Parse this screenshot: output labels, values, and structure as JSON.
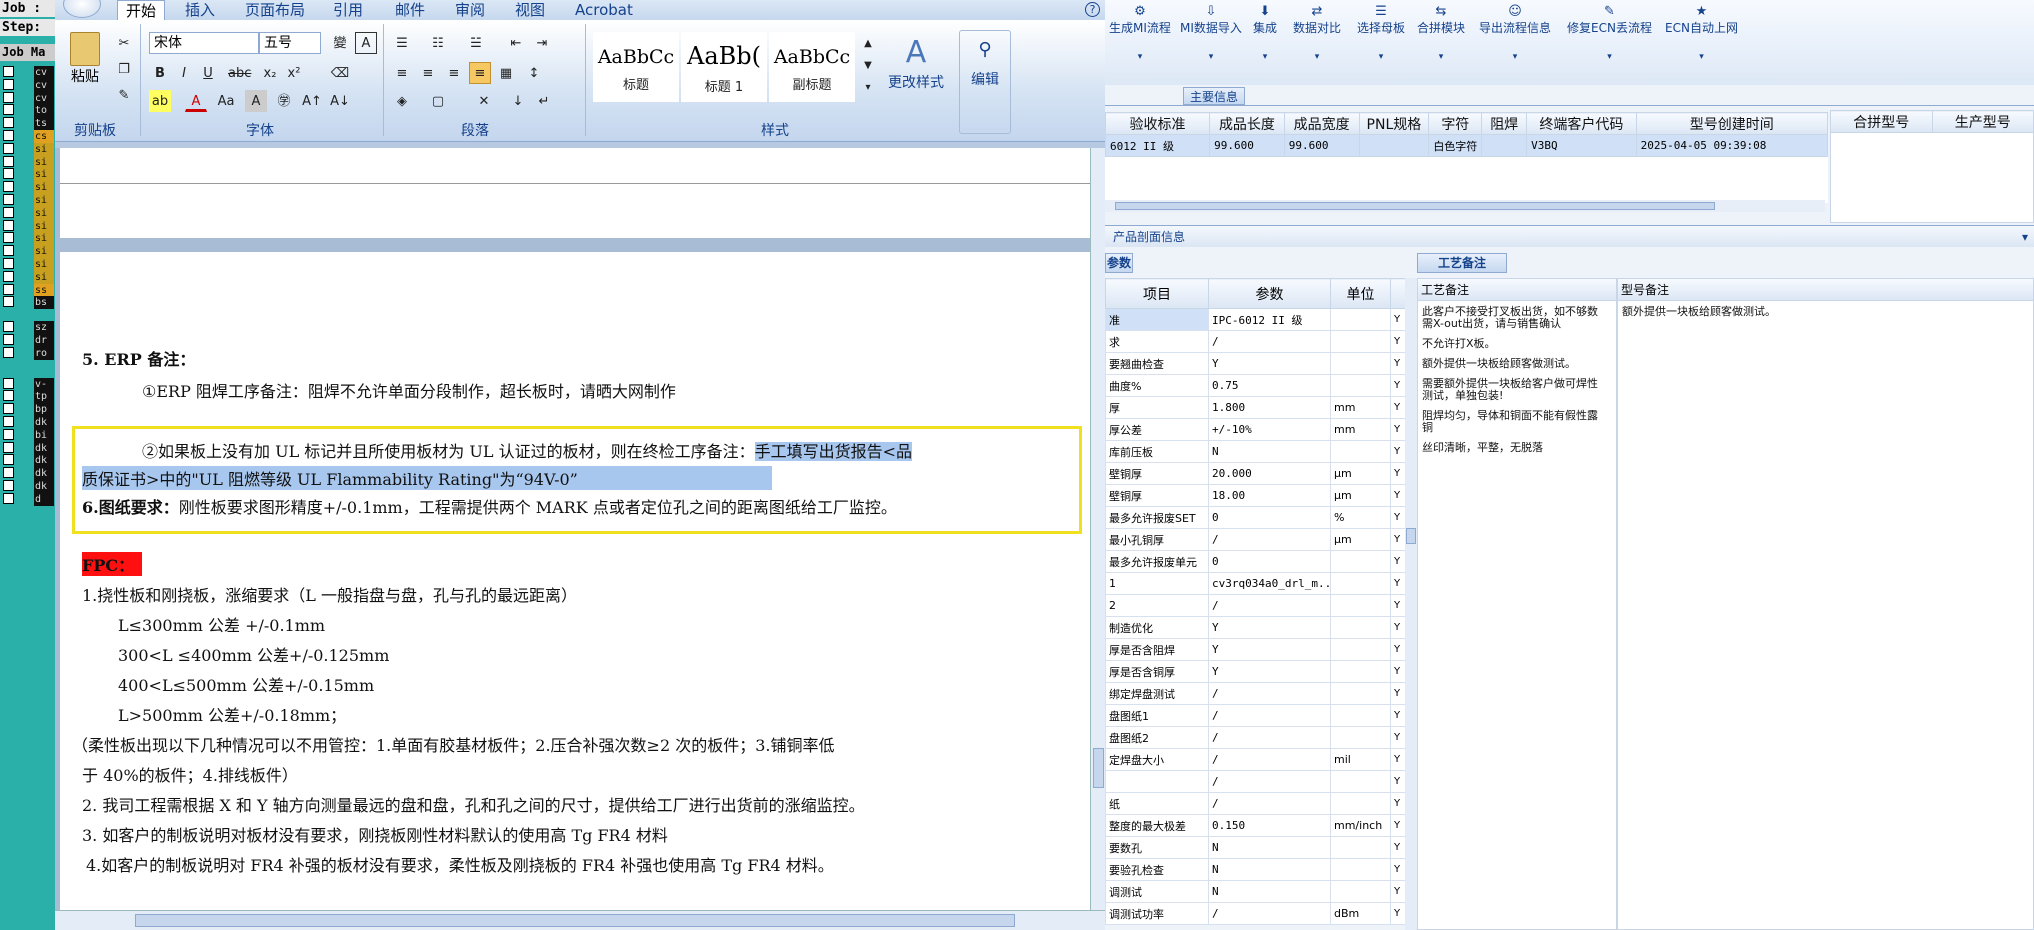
{
  "terminal": {
    "job_label": "Job :",
    "step_label": "Step:",
    "job_header": "Job Ma",
    "rows": [
      {
        "text": "cv",
        "color": "dark"
      },
      {
        "text": "cv",
        "color": "dark"
      },
      {
        "text": "cv",
        "color": "dark"
      },
      {
        "text": "to",
        "color": "dark"
      },
      {
        "text": "ts",
        "color": "dark"
      },
      {
        "text": "cs",
        "color": "orange"
      },
      {
        "text": "si",
        "color": "yellow"
      },
      {
        "text": "si",
        "color": "yellow"
      },
      {
        "text": "si",
        "color": "yellow"
      },
      {
        "text": "si",
        "color": "yellow"
      },
      {
        "text": "si",
        "color": "yellow"
      },
      {
        "text": "si",
        "color": "yellow"
      },
      {
        "text": "si",
        "color": "yellow"
      },
      {
        "text": "si",
        "color": "yellow"
      },
      {
        "text": "si",
        "color": "yellow"
      },
      {
        "text": "si",
        "color": "yellow"
      },
      {
        "text": "si",
        "color": "yellow"
      },
      {
        "text": "ss",
        "color": "orange"
      },
      {
        "text": "bs",
        "color": "dark"
      },
      {
        "text": "sz",
        "color": "dark"
      },
      {
        "text": "dr",
        "color": "dark"
      },
      {
        "text": "ro",
        "color": "dark"
      },
      {
        "text": "v-",
        "color": "dark"
      },
      {
        "text": "tp",
        "color": "dark"
      },
      {
        "text": "bp",
        "color": "dark"
      },
      {
        "text": "dk",
        "color": "dark"
      },
      {
        "text": "bi",
        "color": "dark"
      },
      {
        "text": "dk",
        "color": "dark"
      },
      {
        "text": "dk",
        "color": "dark"
      },
      {
        "text": "dk",
        "color": "dark"
      },
      {
        "text": "dk",
        "color": "dark"
      },
      {
        "text": "d",
        "color": "dark"
      }
    ]
  },
  "word": {
    "tabs": [
      "开始",
      "插入",
      "页面布局",
      "引用",
      "邮件",
      "审阅",
      "视图",
      "Acrobat"
    ],
    "groups": {
      "clipboard": "剪贴板",
      "font": "字体",
      "paragraph": "段落",
      "styles": "样式"
    },
    "paste_label": "粘贴",
    "font_name": "宋体",
    "font_size": "五号",
    "styles": [
      {
        "sample": "AaBbCc",
        "name": "标题"
      },
      {
        "sample": "AaBb(",
        "name": "标题 1"
      },
      {
        "sample": "AaBbCc",
        "name": "副标题"
      }
    ],
    "change_styles": "更改样式",
    "edit_label": "编辑",
    "doc": {
      "erp_heading": "5. ERP 备注：",
      "erp_1": "①ERP 阻焊工序备注：阻焊不允许单面分段制作，超长板时，请晒大网制作",
      "erp_2_a": "②如果板上没有加 UL 标记并且所使用板材为 UL 认证过的板材，则在终检工序备注：",
      "erp_2_b": "手工填写出货报告<品",
      "erp_2_c": "质保证书>中的\"UL 阻燃等级 UL Flammability Rating\"为“94V-0”",
      "drawing_heading": "6.图纸要求：",
      "drawing_text": "刚性板要求图形精度+/-0.1mm，工程需提供两个 MARK 点或者定位孔之间的距离图纸给工厂监控。",
      "fpc": "FPC：",
      "item1": "1.挠性板和刚挠板，涨缩要求（L 一般指盘与盘，孔与孔的最远距离）",
      "tol1": "L≤300mm 公差 +/-0.1mm",
      "tol2": "300<L ≤400mm 公差+/-0.125mm",
      "tol3": "400<L≤500mm 公差+/-0.15mm",
      "tol4": "L>500mm 公差+/-0.18mm；",
      "note_a": "（柔性板出现以下几种情况可以不用管控：1.单面有胶基材板件；2.压合补强次数≥2 次的板件；3.铺铜率低",
      "note_b": "于 40%的板件；4.排线板件）",
      "item2": "2.   我司工程需根据 X 和 Y 轴方向测量最远的盘和盘，孔和孔之间的尺寸，提供给工厂进行出货前的涨缩监控。",
      "item3": "3. 如客户的制板说明对板材没有要求，刚挠板刚性材料默认的使用高 Tg FR4 材料",
      "item4": "4.如客户的制板说明对 FR4 补强的板材没有要求，柔性板及刚挠板的 FR4 补强也使用高 Tg FR4 材料。"
    }
  },
  "erp": {
    "toolbar": [
      "生成MI流程",
      "MI数据导入",
      "集成",
      "数据对比",
      "选择母板",
      "合拼模块",
      "导出流程信息",
      "修复ECN丢流程",
      "ECN自动上网"
    ],
    "main_info_tab": "主要信息",
    "main_headers": [
      "验收标准",
      "成品长度",
      "成品宽度",
      "PNL规格",
      "字符",
      "阻焊",
      "终端客户代码",
      "型号创建时间"
    ],
    "main_row": [
      "6012 II 级",
      "99.600",
      "99.600",
      "",
      "白色字符",
      "",
      "V3BQ",
      "2025-04-05 09:39:08"
    ],
    "merge_headers": [
      "合拼型号",
      "生产型号"
    ],
    "profile_label": "产品剖面信息",
    "params_tab": "参数",
    "notes_tab": "工艺备注",
    "params_headers": [
      "项目",
      "参数",
      "单位"
    ],
    "params": [
      [
        "准",
        "IPC-6012 II 级",
        ""
      ],
      [
        "求",
        "/",
        ""
      ],
      [
        "要翘曲检查",
        "Y",
        ""
      ],
      [
        "曲度%",
        "0.75",
        ""
      ],
      [
        "厚",
        "1.800",
        "mm"
      ],
      [
        "厚公差",
        "+/-10%",
        "mm"
      ],
      [
        "库前压板",
        "N",
        ""
      ],
      [
        "壁铜厚",
        "20.000",
        "μm"
      ],
      [
        "壁铜厚",
        "18.00",
        "μm"
      ],
      [
        "最多允许报废SET",
        "0",
        "%"
      ],
      [
        "最小孔铜厚",
        "/",
        "μm"
      ],
      [
        "最多允许报废单元",
        "0",
        ""
      ],
      [
        "1",
        "cv3rq034a0_drl_m...",
        ""
      ],
      [
        "2",
        "/",
        ""
      ],
      [
        "制造优化",
        "Y",
        ""
      ],
      [
        "厚是否含阻焊",
        "Y",
        ""
      ],
      [
        "厚是否含铜厚",
        "Y",
        ""
      ],
      [
        "绑定焊盘测试",
        "/",
        ""
      ],
      [
        "盘图纸1",
        "/",
        ""
      ],
      [
        "盘图纸2",
        "/",
        ""
      ],
      [
        "定焊盘大小",
        "/",
        "mil"
      ],
      [
        "",
        "/",
        ""
      ],
      [
        "纸",
        "/",
        ""
      ],
      [
        "整度的最大极差",
        "0.150",
        "mm/inch"
      ],
      [
        "要数孔",
        "N",
        ""
      ],
      [
        "要验孔检查",
        "N",
        ""
      ],
      [
        "调测试",
        "N",
        ""
      ],
      [
        "调测试功率",
        "/",
        "dBm"
      ]
    ],
    "notes_headers": [
      "工艺备注",
      "型号备注"
    ],
    "notes": [
      "此客户不接受打叉板出货，如不够数需X-out出货，请与销售确认",
      "不允许打X板。",
      "额外提供一块板给顾客做测试。",
      "需要额外提供一块板给客户做可焊性测试，单独包装!",
      "阻焊均匀，导体和铜面不能有假性露铜",
      "丝印清晰，平整，无脱落"
    ],
    "model_note": "额外提供一块板给顾客做测试。"
  }
}
